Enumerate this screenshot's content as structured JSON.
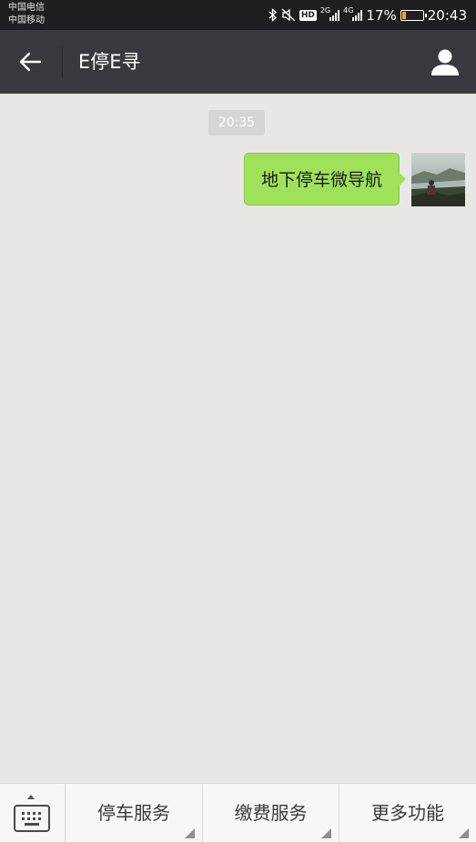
{
  "status_bar": {
    "carrier_1": "中国电信",
    "carrier_2": "中国移动",
    "hd_label": "HD",
    "network_1": "2G",
    "network_2": "4G",
    "battery_percent_text": "17%",
    "battery_level": 0.17,
    "time": "20:43",
    "battery_color": "#f6a623",
    "icons": [
      "bluetooth-icon",
      "mute-icon",
      "hd-icon",
      "signal-icon",
      "battery-icon"
    ]
  },
  "title_bar": {
    "title": "E停E寻",
    "back_icon": "arrow-left-icon",
    "profile_icon": "person-icon"
  },
  "chat": {
    "timestamp": "20:35",
    "messages": [
      {
        "sender": "me",
        "text": "地下停车微导航"
      }
    ],
    "bubble_color": "#9fe15a"
  },
  "bottom_menu": {
    "keyboard_icon": "keyboard-icon",
    "items": [
      {
        "label": "停车服务"
      },
      {
        "label": "缴费服务"
      },
      {
        "label": "更多功能"
      }
    ]
  },
  "colors": {
    "status_bar_bg": "#1f1f21",
    "title_bar_bg": "#393a3f",
    "chat_bg": "#e8e7e6",
    "bottom_bar_bg": "#f7f7f7"
  }
}
